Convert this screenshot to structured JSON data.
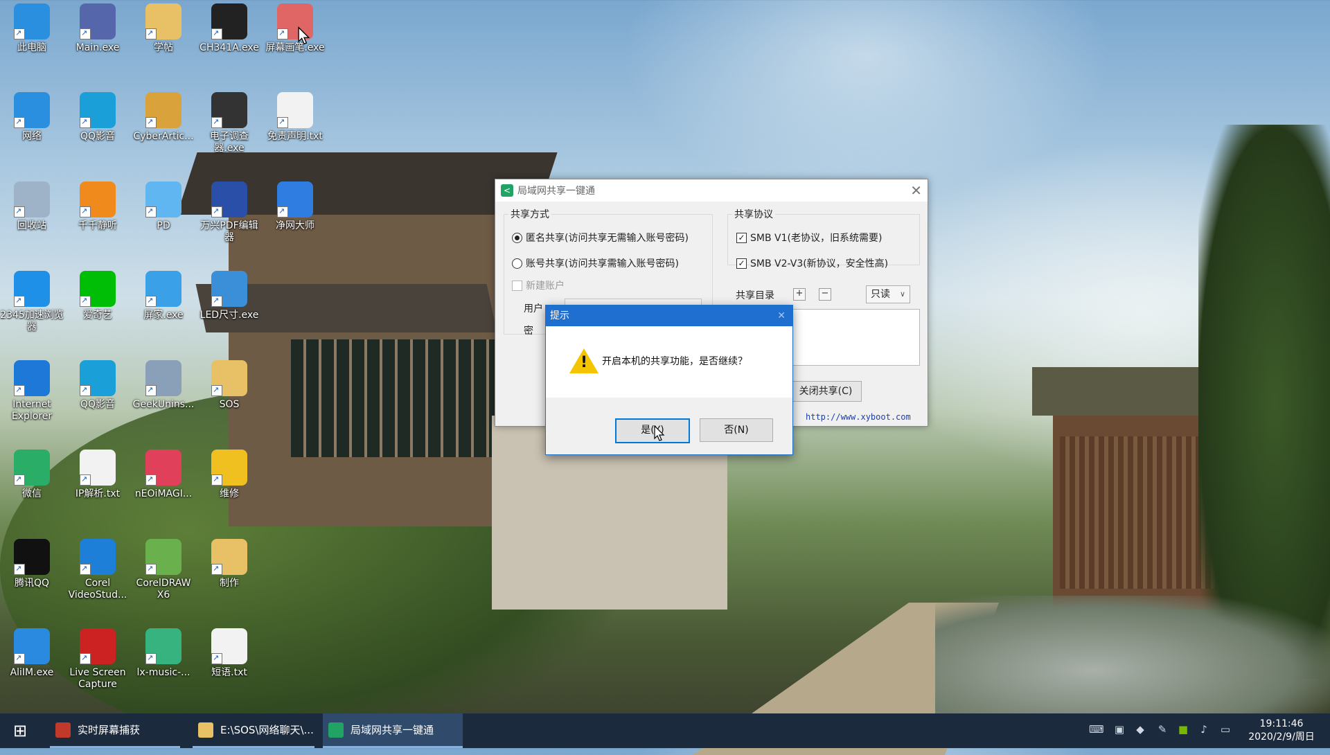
{
  "desktop": {
    "icons": [
      {
        "label": "此电脑",
        "color": "#2b8fe0"
      },
      {
        "label": "Main.exe",
        "color": "#5566aa"
      },
      {
        "label": "学帖",
        "color": "#e8c066"
      },
      {
        "label": "CH341A.exe",
        "color": "#222222"
      },
      {
        "label": "屏幕画笔.exe",
        "color": "#e06666"
      },
      {
        "label": "网络",
        "color": "#2b8fe0"
      },
      {
        "label": "QQ影音",
        "color": "#1b9fd8"
      },
      {
        "label": "CyberArtic...",
        "color": "#d9a23a"
      },
      {
        "label": "电子调查器.exe",
        "color": "#333333"
      },
      {
        "label": "免责声明.txt",
        "color": "#f2f2f2"
      },
      {
        "label": "回收站",
        "color": "#9fb3c8"
      },
      {
        "label": "千千静听",
        "color": "#f08a1c"
      },
      {
        "label": "PD",
        "color": "#5fb6f0"
      },
      {
        "label": "万兴PDF编辑器",
        "color": "#2a4fa8"
      },
      {
        "label": "净网大师",
        "color": "#2f7de1"
      },
      {
        "label": "2345加速浏览器",
        "color": "#1e90e8"
      },
      {
        "label": "爱奇艺",
        "color": "#00be06"
      },
      {
        "label": "屏家.exe",
        "color": "#3aa0e8"
      },
      {
        "label": "LED尺寸.exe",
        "color": "#3b8ed8"
      },
      {
        "label": "Internet Explorer",
        "color": "#1e78d8"
      },
      {
        "label": "QQ影音",
        "color": "#1b9fd8"
      },
      {
        "label": "GeekUnins...",
        "color": "#8aa0b8"
      },
      {
        "label": "SOS",
        "color": "#e8c066"
      },
      {
        "label": "微信",
        "color": "#2aae67"
      },
      {
        "label": "IP解析.txt",
        "color": "#f2f2f2"
      },
      {
        "label": "nEOiMAGI...",
        "color": "#e0405a"
      },
      {
        "label": "维修",
        "color": "#f0c020"
      },
      {
        "label": "腾讯QQ",
        "color": "#111111"
      },
      {
        "label": "Corel VideoStud...",
        "color": "#1e7fd8"
      },
      {
        "label": "CorelDRAW X6",
        "color": "#6ab04c"
      },
      {
        "label": "制作",
        "color": "#e8c066"
      },
      {
        "label": "AliIM.exe",
        "color": "#2a8ae0"
      },
      {
        "label": "Live Screen Capture",
        "color": "#cc2222"
      },
      {
        "label": "lx-music-...",
        "color": "#36b37e"
      },
      {
        "label": "短语.txt",
        "color": "#f2f2f2"
      }
    ]
  },
  "app": {
    "title": "局域网共享一键通",
    "share_mode": {
      "group_title": "共享方式",
      "anonymous": "匿名共享(访问共享无需输入账号密码)",
      "account": "账号共享(访问共享需输入账号密码)",
      "new_account": "新建账户",
      "user_label": "用户",
      "pwd_label": "密"
    },
    "protocol": {
      "group_title": "共享协议",
      "smb1": "SMB V1(老协议，旧系统需要)",
      "smb2": "SMB V2-V3(新协议，安全性高)",
      "smb1_checked": "✓",
      "smb2_checked": "✓"
    },
    "dir": {
      "label": "共享目录",
      "add": "+",
      "remove": "−",
      "mode": "只读"
    },
    "close_share": "关闭共享(C)",
    "link": "http://www.xyboot.com"
  },
  "dialog": {
    "title": "提示",
    "close": "✕",
    "message": "开启本机的共享功能，是否继续？",
    "warn_glyph": "!",
    "yes": "是(Y)",
    "no": "否(N)"
  },
  "taskbar": {
    "start_glyph": "⊞",
    "items": [
      {
        "label": "实时屏幕捕获",
        "color": "#c0392b"
      },
      {
        "label": "E:\\SOS\\网络聊天\\...",
        "color": "#e8c066"
      },
      {
        "label": "局域网共享一键通",
        "color": "#21a366"
      }
    ],
    "time": "19:11:46",
    "date": "2020/2/9/周日"
  }
}
